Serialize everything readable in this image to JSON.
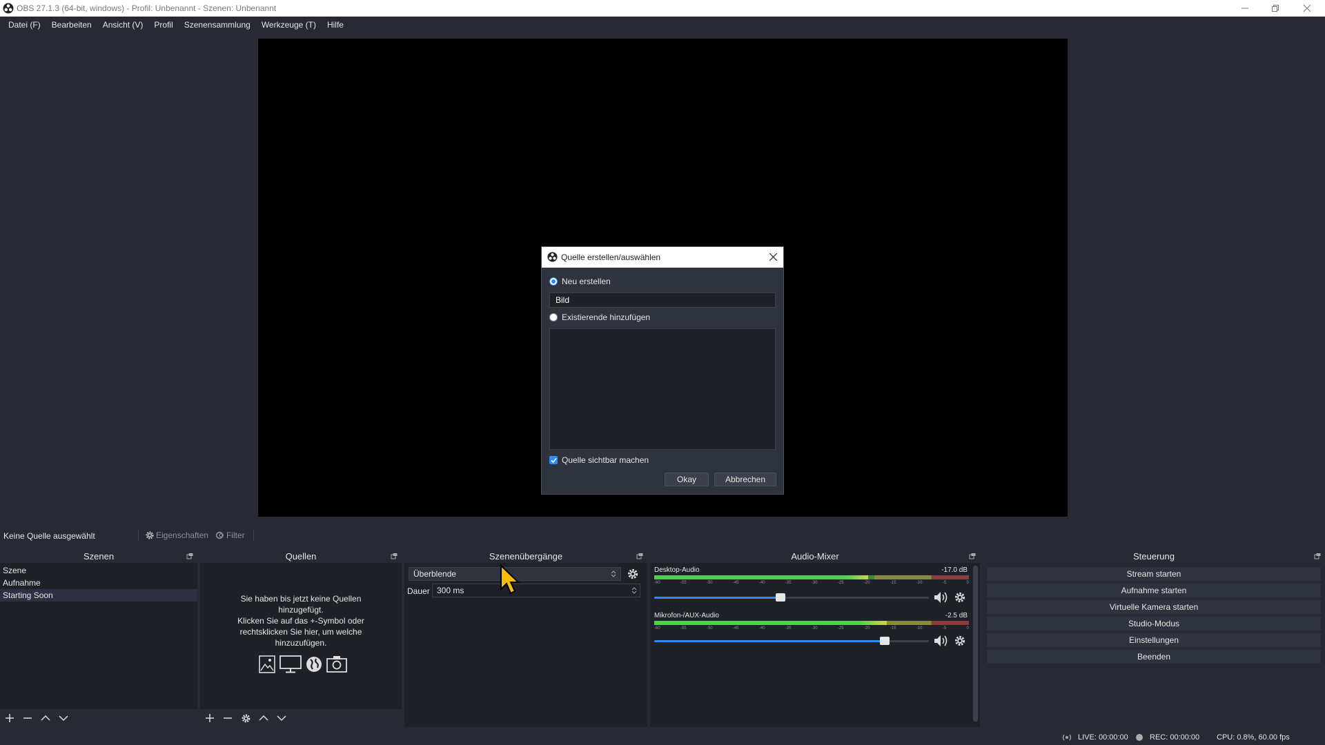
{
  "window": {
    "title": "OBS 27.1.3 (64-bit, windows) - Profil: Unbenannt - Szenen: Unbenannt"
  },
  "menu": [
    "Datei (F)",
    "Bearbeiten",
    "Ansicht (V)",
    "Profil",
    "Szenensammlung",
    "Werkzeuge (T)",
    "Hilfe"
  ],
  "dialog": {
    "title": "Quelle erstellen/auswählen",
    "new_label": "Neu erstellen",
    "name_value": "Bild",
    "existing_label": "Existierende hinzufügen",
    "visible_label": "Quelle sichtbar machen",
    "ok_label": "Okay",
    "cancel_label": "Abbrechen"
  },
  "source_toolbar": {
    "no_source": "Keine Quelle ausgewählt",
    "properties": "Eigenschaften",
    "filters": "Filter"
  },
  "scenes": {
    "title": "Szenen",
    "items": [
      "Szene",
      "Aufnahme",
      "Starting Soon"
    ],
    "selected": "Starting Soon"
  },
  "sources": {
    "title": "Quellen",
    "empty_line1": "Sie haben bis jetzt keine Quellen",
    "empty_line2": "hinzugefügt.",
    "empty_line3": "Klicken Sie auf das +-Symbol oder",
    "empty_line4": "rechtsklicken Sie hier, um welche",
    "empty_line5": "hinzuzufügen."
  },
  "transitions": {
    "title": "Szenenübergänge",
    "selected": "Überblende",
    "duration_label": "Dauer",
    "duration_value": "300 ms"
  },
  "mixer": {
    "title": "Audio-Mixer",
    "channels": [
      {
        "name": "Desktop-Audio",
        "db": "-17.0 dB",
        "level": 0.46
      },
      {
        "name": "Mikrofon-/AUX-Audio",
        "db": "-2.5 dB",
        "level": 0.84
      }
    ],
    "tick_labels": [
      "-60",
      "-55",
      "-50",
      "-45",
      "-40",
      "-35",
      "-30",
      "-25",
      "-20",
      "-15",
      "-10",
      "-5",
      "0"
    ]
  },
  "controls": {
    "title": "Steuerung",
    "buttons": [
      "Stream starten",
      "Aufnahme starten",
      "Virtuelle Kamera starten",
      "Studio-Modus",
      "Einstellungen",
      "Beenden"
    ]
  },
  "status": {
    "live": "LIVE: 00:00:00",
    "rec": "REC: 00:00:00",
    "cpu": "CPU: 0.8%, 60.00 fps"
  },
  "colors": {
    "accent": "#2f8bff",
    "background": "#272a33",
    "panel": "#1e2128"
  }
}
